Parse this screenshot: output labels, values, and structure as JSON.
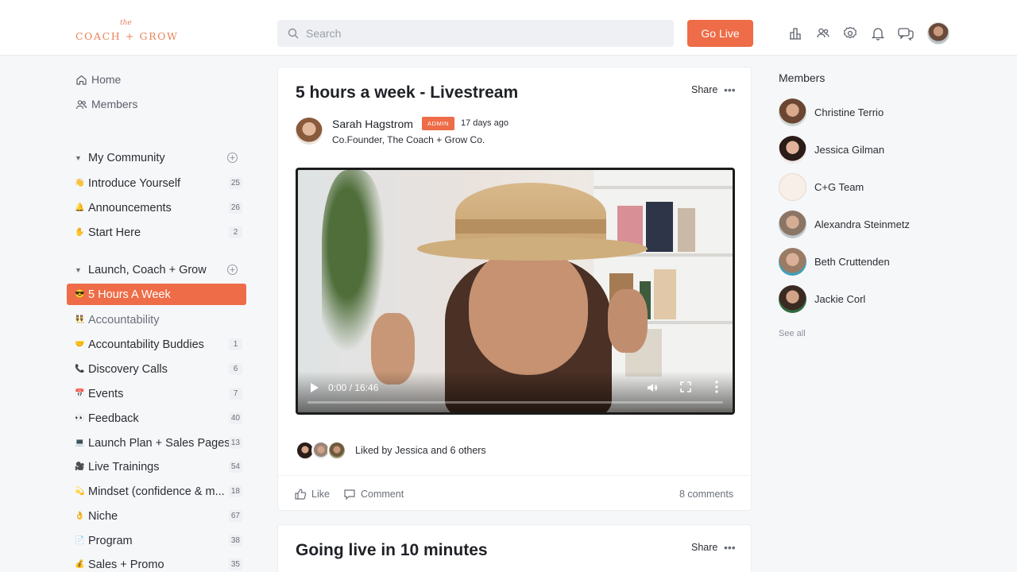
{
  "brand": {
    "logo_small": "the",
    "logo_text": "COACH + GROW"
  },
  "search": {
    "placeholder": "Search"
  },
  "header": {
    "go_live_label": "Go Live",
    "icons": [
      "leaderboard-icon",
      "members-icon",
      "settings-icon",
      "notifications-icon",
      "messages-icon"
    ]
  },
  "sidebar": {
    "nav": [
      {
        "label": "Home",
        "icon": "home-icon"
      },
      {
        "label": "Members",
        "icon": "members-icon"
      }
    ],
    "groups": [
      {
        "title": "My Community",
        "spaces": [
          {
            "emoji": "👋",
            "label": "Introduce Yourself",
            "count": "25"
          },
          {
            "emoji": "🔔",
            "label": "Announcements",
            "count": "26"
          },
          {
            "emoji": "✋",
            "label": "Start Here",
            "count": "2"
          }
        ]
      },
      {
        "title": "Launch, Coach + Grow",
        "spaces": [
          {
            "emoji": "😎",
            "label": "5 Hours A Week",
            "count": ""
          },
          {
            "emoji": "👯",
            "label": "Accountability",
            "count": ""
          },
          {
            "emoji": "🤝",
            "label": "Accountability Buddies",
            "count": "1"
          },
          {
            "emoji": "📞",
            "label": "Discovery Calls",
            "count": "6"
          },
          {
            "emoji": "📅",
            "label": "Events",
            "count": "7"
          },
          {
            "emoji": "👀",
            "label": "Feedback",
            "count": "40"
          },
          {
            "emoji": "💻",
            "label": "Launch Plan + Sales Pages",
            "count": "13"
          },
          {
            "emoji": "🎥",
            "label": "Live Trainings",
            "count": "54"
          },
          {
            "emoji": "💫",
            "label": "Mindset (confidence & m...",
            "count": "18"
          },
          {
            "emoji": "👌",
            "label": "Niche",
            "count": "67"
          },
          {
            "emoji": "📄",
            "label": "Program",
            "count": "38"
          },
          {
            "emoji": "💰",
            "label": "Sales + Promo",
            "count": "35"
          }
        ]
      }
    ]
  },
  "post1": {
    "title": "5 hours a week - Livestream",
    "share_label": "Share",
    "more_label": "•••",
    "author": "Sarah Hagstrom",
    "badge": "ADMIN",
    "time": "17 days ago",
    "role": "Co.Founder, The Coach + Grow Co.",
    "video": {
      "time": "0:00 / 16:46",
      "progress": 0
    },
    "liked_text": "Liked by Jessica and 6 others",
    "like_label": "Like",
    "comment_label": "Comment",
    "comments_count": "8 comments"
  },
  "post2": {
    "title": "Going live in 10 minutes",
    "share_label": "Share",
    "more_label": "•••"
  },
  "members": {
    "title": "Members",
    "list": [
      {
        "name": "Christine Terrio"
      },
      {
        "name": "Jessica Gilman"
      },
      {
        "name": "C+G Team"
      },
      {
        "name": "Alexandra Steinmetz"
      },
      {
        "name": "Beth Cruttenden"
      },
      {
        "name": "Jackie Corl"
      }
    ],
    "see_all": "See all"
  },
  "colors": {
    "accent": "#ee6c47",
    "logo": "#e8835a"
  }
}
